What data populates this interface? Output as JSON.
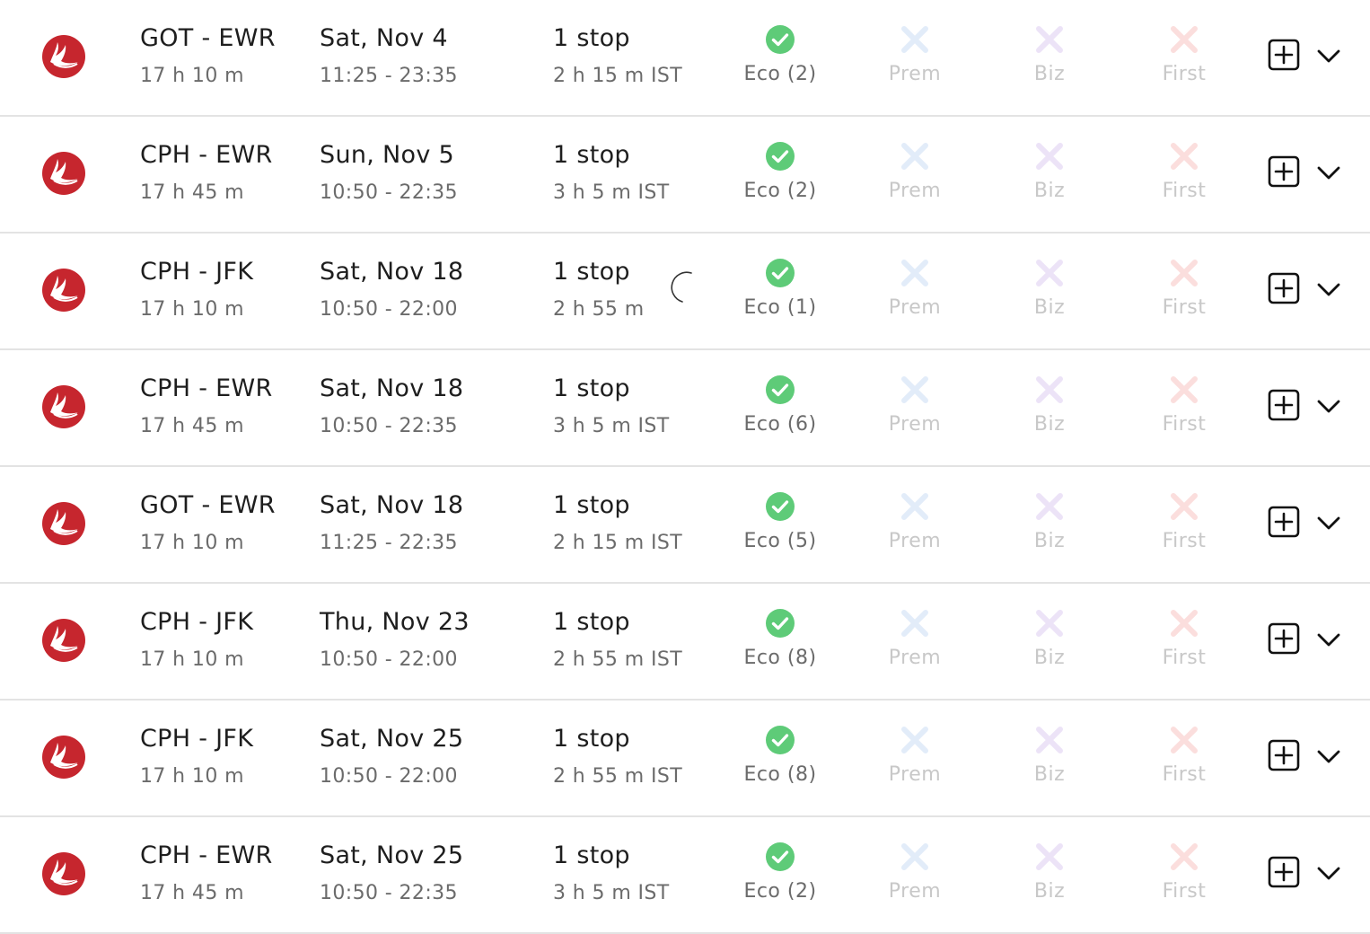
{
  "colors": {
    "airline_red": "#c6262e",
    "available_green": "#5ecb78",
    "prem_unavailable": "#e2ecf9",
    "biz_unavailable": "#ece3f7",
    "first_unavailable": "#fbdedd",
    "eco_label": "#6b6b6b",
    "unavailable_label": "#c8c8c8",
    "divider": "#e3e3e3"
  },
  "icons": {
    "airline_logo": "turkish-airlines-logo",
    "available": "check-circle-icon",
    "unavailable": "x-icon",
    "add": "plus-square-icon",
    "expand": "chevron-down-icon",
    "loading": "loading-spinner-icon"
  },
  "flights": [
    {
      "route": "GOT - EWR",
      "duration": "17 h 10 m",
      "date": "Sat, Nov 4",
      "times": "11:25 - 23:35",
      "stops": "1 stop",
      "layover": "2 h 15 m IST",
      "eco": "Eco (2)",
      "prem": "Prem",
      "biz": "Biz",
      "first": "First"
    },
    {
      "route": "CPH - EWR",
      "duration": "17 h 45 m",
      "date": "Sun, Nov 5",
      "times": "10:50 - 22:35",
      "stops": "1 stop",
      "layover": "3 h 5 m IST",
      "eco": "Eco (2)",
      "prem": "Prem",
      "biz": "Biz",
      "first": "First"
    },
    {
      "route": "CPH - JFK",
      "duration": "17 h 10 m",
      "date": "Sat, Nov 18",
      "times": "10:50 - 22:00",
      "stops": "1 stop",
      "layover": "2 h 55 m IST",
      "eco": "Eco (1)",
      "prem": "Prem",
      "biz": "Biz",
      "first": "First"
    },
    {
      "route": "CPH - EWR",
      "duration": "17 h 45 m",
      "date": "Sat, Nov 18",
      "times": "10:50 - 22:35",
      "stops": "1 stop",
      "layover": "3 h 5 m IST",
      "eco": "Eco (6)",
      "prem": "Prem",
      "biz": "Biz",
      "first": "First"
    },
    {
      "route": "GOT - EWR",
      "duration": "17 h 10 m",
      "date": "Sat, Nov 18",
      "times": "11:25 - 22:35",
      "stops": "1 stop",
      "layover": "2 h 15 m IST",
      "eco": "Eco (5)",
      "prem": "Prem",
      "biz": "Biz",
      "first": "First"
    },
    {
      "route": "CPH - JFK",
      "duration": "17 h 10 m",
      "date": "Thu, Nov 23",
      "times": "10:50 - 22:00",
      "stops": "1 stop",
      "layover": "2 h 55 m IST",
      "eco": "Eco (8)",
      "prem": "Prem",
      "biz": "Biz",
      "first": "First"
    },
    {
      "route": "CPH - JFK",
      "duration": "17 h 10 m",
      "date": "Sat, Nov 25",
      "times": "10:50 - 22:00",
      "stops": "1 stop",
      "layover": "2 h 55 m IST",
      "eco": "Eco (8)",
      "prem": "Prem",
      "biz": "Biz",
      "first": "First"
    },
    {
      "route": "CPH - EWR",
      "duration": "17 h 45 m",
      "date": "Sat, Nov 25",
      "times": "10:50 - 22:35",
      "stops": "1 stop",
      "layover": "3 h 5 m IST",
      "eco": "Eco (2)",
      "prem": "Prem",
      "biz": "Biz",
      "first": "First"
    }
  ]
}
